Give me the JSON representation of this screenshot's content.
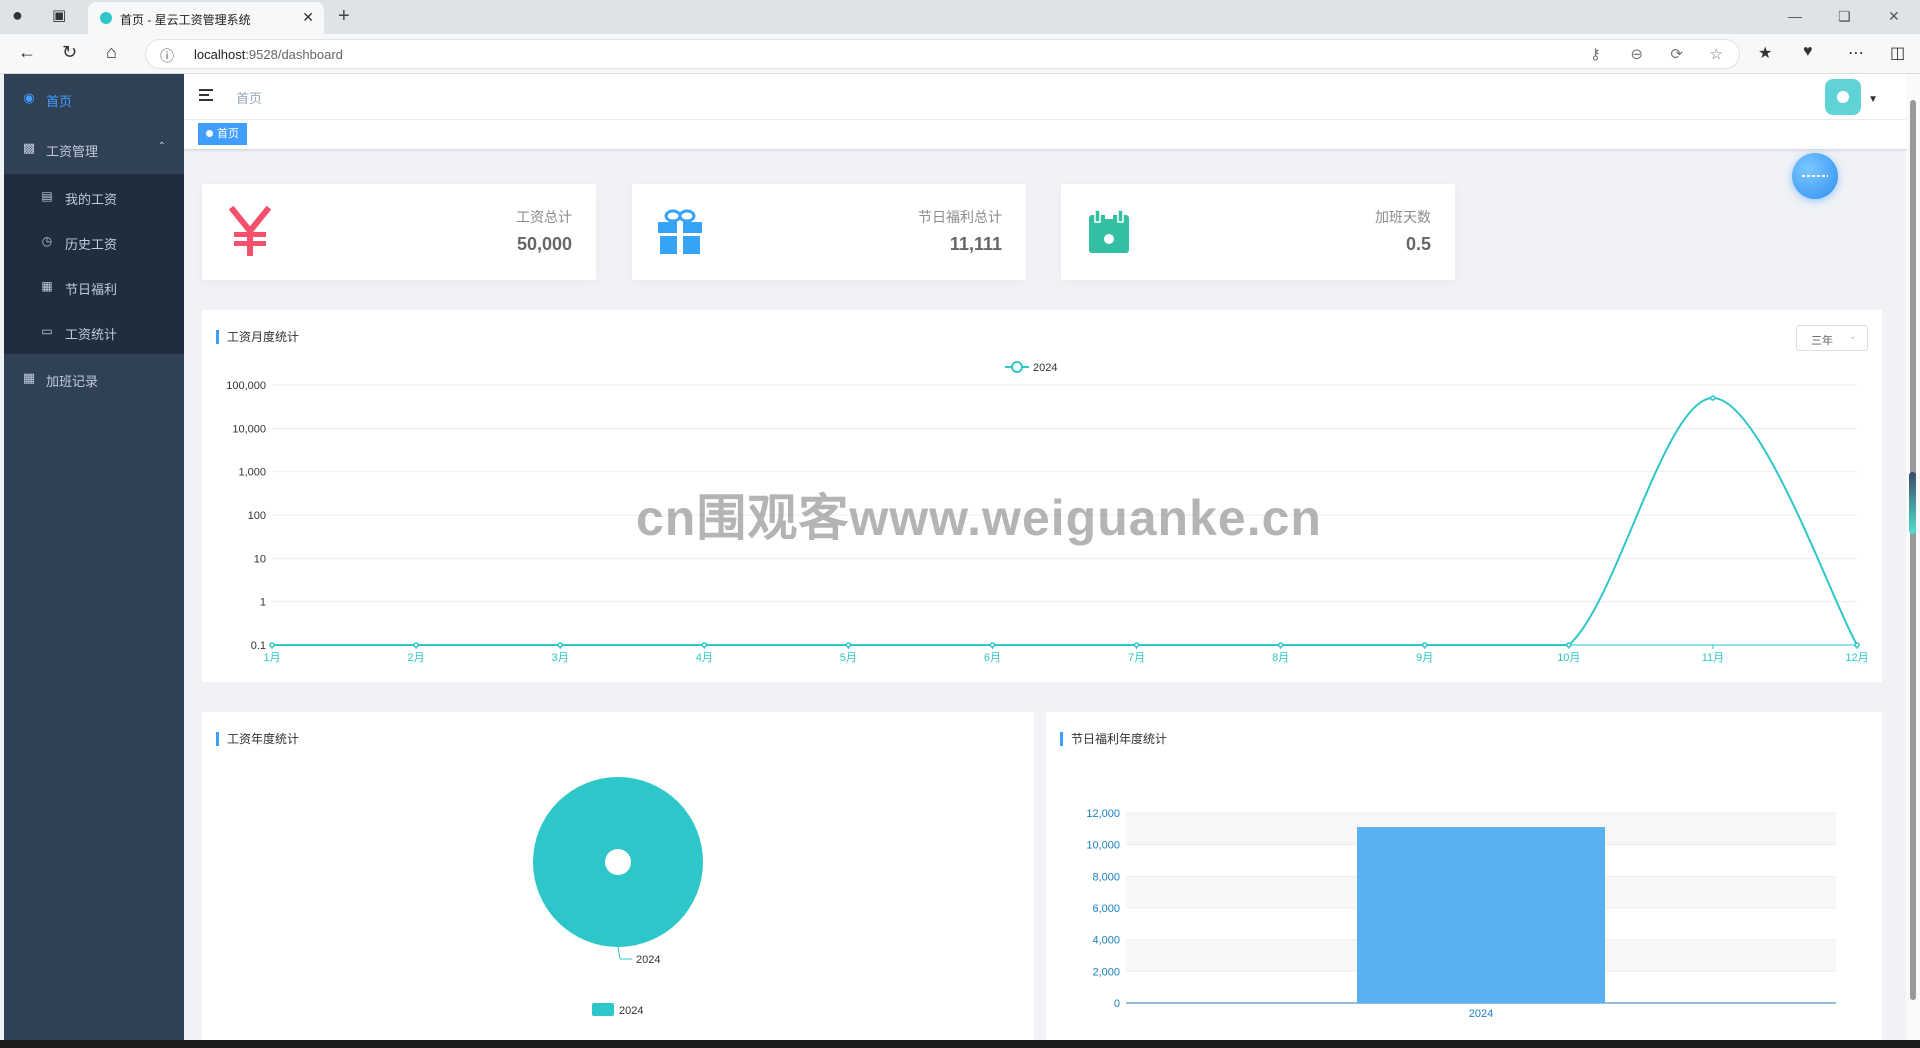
{
  "browser": {
    "tab_title": "首页 - 星云工资管理系统",
    "url_host": "localhost",
    "url_rest": ":9528/dashboard"
  },
  "sidebar": {
    "items": [
      {
        "label": "首页",
        "icon": "dashboard-icon",
        "active": true
      },
      {
        "label": "工资管理",
        "icon": "chart-bar-icon",
        "expanded": true,
        "children": [
          {
            "label": "我的工资",
            "icon": "money-icon"
          },
          {
            "label": "历史工资",
            "icon": "clock-icon"
          },
          {
            "label": "节日福利",
            "icon": "gift-icon"
          },
          {
            "label": "工资统计",
            "icon": "presentation-icon"
          }
        ]
      },
      {
        "label": "加班记录",
        "icon": "calendar-icon"
      }
    ]
  },
  "header": {
    "breadcrumb": "首页",
    "tag": "首页"
  },
  "stats": [
    {
      "label": "工资总计",
      "value": "50,000",
      "icon": "yen-icon",
      "color": "#f4516c"
    },
    {
      "label": "节日福利总计",
      "value": "11,111",
      "icon": "gift-icon",
      "color": "#36a3f7"
    },
    {
      "label": "加班天数",
      "value": "0.5",
      "icon": "calendar-icon",
      "color": "#34bfa3"
    }
  ],
  "panels": {
    "monthly_title": "工资月度统计",
    "yearly_title": "工资年度统计",
    "bonus_title": "节日福利年度统计",
    "range_select": "三年"
  },
  "watermark": "cn围观客www.weiguanke.cn",
  "chart_data": [
    {
      "type": "line",
      "title": "工资月度统计",
      "categories": [
        "1月",
        "2月",
        "3月",
        "4月",
        "5月",
        "6月",
        "7月",
        "8月",
        "9月",
        "10月",
        "11月",
        "12月"
      ],
      "series": [
        {
          "name": "2024",
          "values": [
            0.1,
            0.1,
            0.1,
            0.1,
            0.1,
            0.1,
            0.1,
            0.1,
            0.1,
            0.1,
            50000,
            0.1
          ]
        }
      ],
      "y_scale": "log",
      "y_ticks": [
        "0.1",
        "1",
        "10",
        "100",
        "1,000",
        "10,000",
        "100,000"
      ],
      "legend": "top-center",
      "color": "#2ec7c9"
    },
    {
      "type": "pie",
      "title": "工资年度统计",
      "slices": [
        {
          "name": "2024",
          "value": 50000
        }
      ],
      "legend": "bottom-center",
      "color": "#2ec7c9"
    },
    {
      "type": "bar",
      "title": "节日福利年度统计",
      "categories": [
        "2024"
      ],
      "values": [
        11111
      ],
      "ylim": [
        0,
        12000
      ],
      "y_ticks": [
        "0",
        "2,000",
        "4,000",
        "6,000",
        "8,000",
        "10,000",
        "12,000"
      ],
      "color": "#5ab1ef"
    }
  ]
}
